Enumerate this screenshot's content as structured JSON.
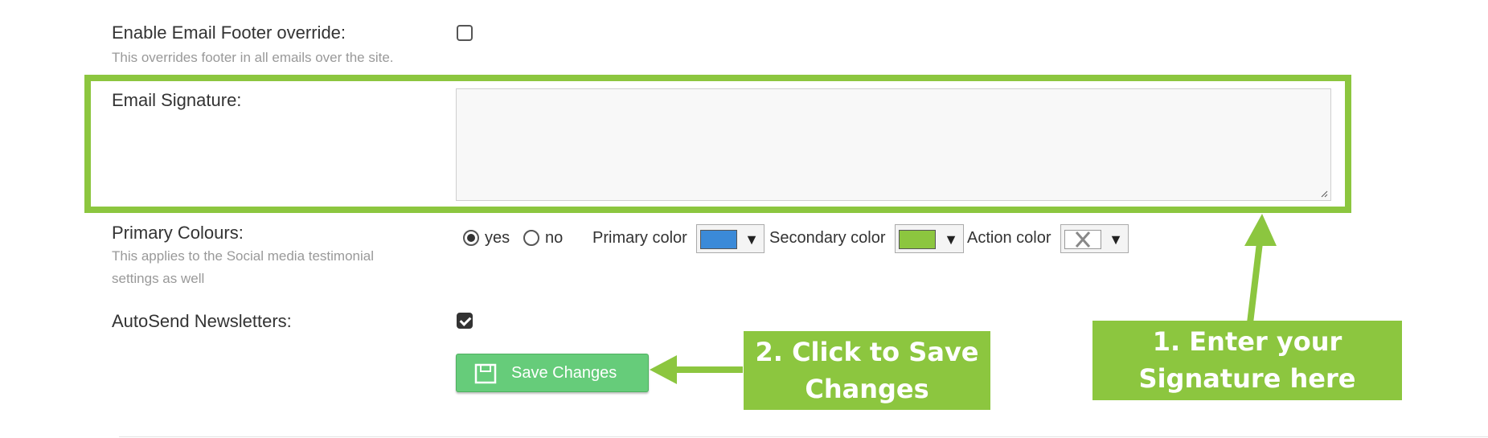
{
  "email_footer": {
    "label": "Enable Email Footer override:",
    "help": "This overrides footer in all emails over the site.",
    "checked": false
  },
  "email_signature": {
    "label": "Email Signature:",
    "value": ""
  },
  "primary_colours": {
    "label": "Primary Colours:",
    "help_line1": "This applies to the Social media testimonial",
    "help_line2": "settings as well",
    "options": [
      {
        "label": "yes",
        "selected": true
      },
      {
        "label": "no",
        "selected": false
      }
    ],
    "primary_color_label": "Primary color",
    "secondary_color_label": "Secondary color",
    "action_color_label": "Action color",
    "primary_color": "#3b8ad8",
    "secondary_color": "#8cc63f",
    "action_color": "none"
  },
  "autosend": {
    "label": "AutoSend Newsletters:",
    "checked": true
  },
  "save_button": {
    "label": "Save Changes"
  },
  "callouts": {
    "save_line1": "2. Click to Save",
    "save_line2": "Changes",
    "signature_line1": "1. Enter your",
    "signature_line2": "Signature here",
    "color": "#8cc63f"
  }
}
